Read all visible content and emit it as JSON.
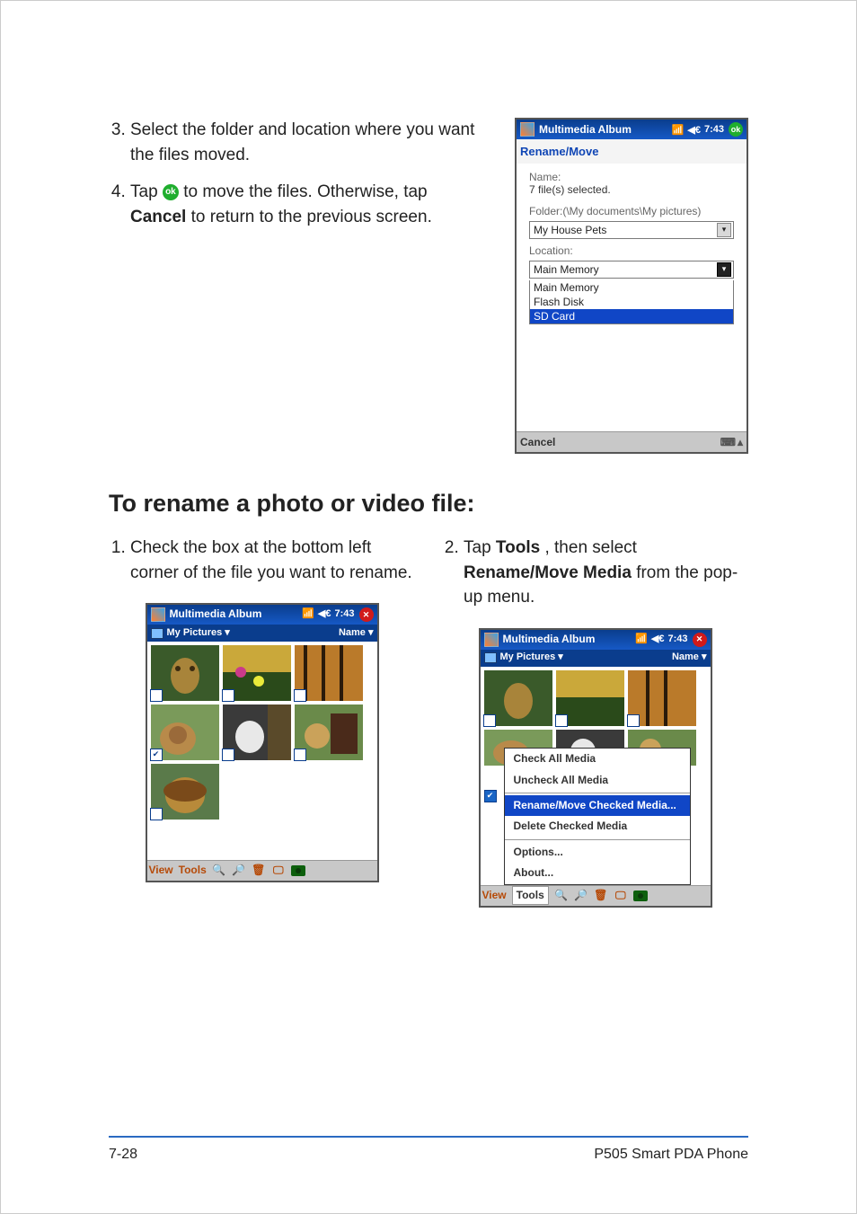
{
  "instructions_top": {
    "item3": "Select the folder and location where you want the files moved.",
    "item4_a": "Tap ",
    "item4_ok": "ok",
    "item4_b": " to move the files. Otherwise, tap ",
    "item4_cancel": "Cancel",
    "item4_c": " to return to the previous screen."
  },
  "section_heading": "To rename a photo or video file:",
  "instructions_bottom": {
    "item1": "Check the box at the bottom left corner of the file you want to rename.",
    "item2_a": "Tap ",
    "item2_tools": "Tools",
    "item2_b": ", then select ",
    "item2_rename": "Rename/Move Media",
    "item2_c": " from the pop-up menu."
  },
  "pda_common": {
    "app_title": "Multimedia Album",
    "time": "7:43"
  },
  "rename_move_screen": {
    "heading": "Rename/Move",
    "name_label": "Name:",
    "name_value": "7 file(s) selected.",
    "folder_label": "Folder:(\\My documents\\My pictures)",
    "folder_selected": "My House Pets",
    "location_label": "Location:",
    "location_selected": "Main Memory",
    "location_options": [
      "Main Memory",
      "Flash Disk",
      "SD Card"
    ],
    "cancel": "Cancel"
  },
  "album_screen": {
    "folder_name": "My Pictures",
    "sort_label": "Name",
    "toolbar": {
      "view": "View",
      "tools": "Tools"
    }
  },
  "tools_menu": {
    "check_all": "Check All Media",
    "uncheck_all": "Uncheck All Media",
    "rename": "Rename/Move Checked Media...",
    "delete": "Delete Checked Media",
    "options": "Options...",
    "about": "About..."
  },
  "footer": {
    "page": "7-28",
    "product": "P505 Smart PDA Phone"
  }
}
